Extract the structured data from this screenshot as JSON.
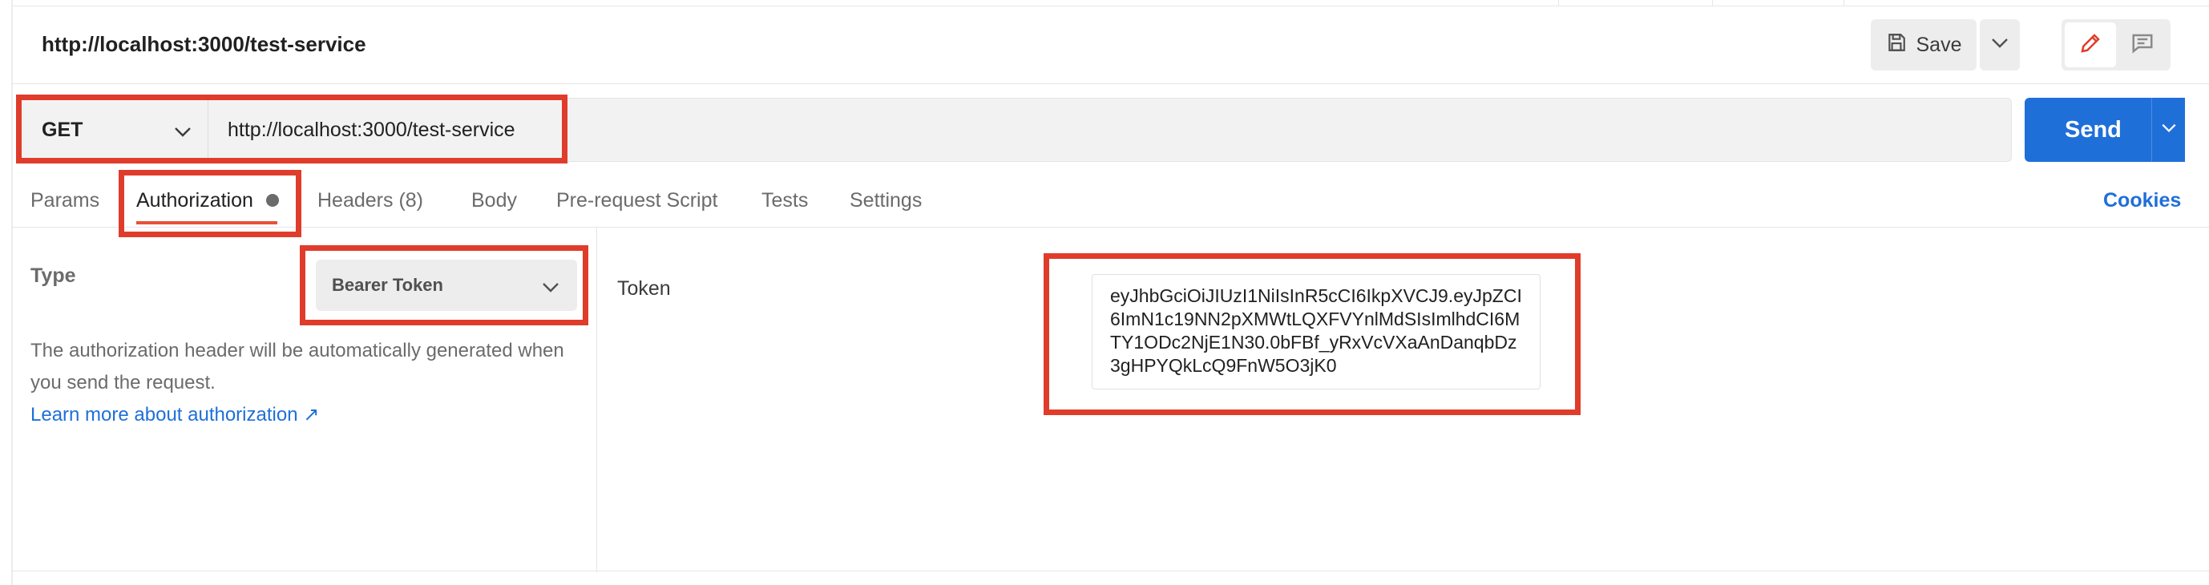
{
  "request": {
    "title": "http://localhost:3000/test-service",
    "method": "GET",
    "url": "http://localhost:3000/test-service"
  },
  "header": {
    "save_label": "Save"
  },
  "send": {
    "label": "Send"
  },
  "tabs": [
    {
      "label": "Params"
    },
    {
      "label": "Authorization"
    },
    {
      "label": "Headers (8)"
    },
    {
      "label": "Body"
    },
    {
      "label": "Pre-request Script"
    },
    {
      "label": "Tests"
    },
    {
      "label": "Settings"
    }
  ],
  "cookies_label": "Cookies",
  "auth": {
    "type_label": "Type",
    "type_value": "Bearer Token",
    "description": "The authorization header will be automatically generated when you send the request.",
    "learn_more": "Learn more about authorization ↗",
    "token_label": "Token",
    "token_value": "eyJhbGciOiJIUzI1NiIsInR5cCI6IkpXVCJ9.eyJpZCI6ImN1c19NN2pXMWtLQXFVYnlMdSIsImlhdCI6MTY1ODc2NjE1N30.0bFBf_yRxVcVXaAnDanqbDz3gHPYQkLcQ9FnW5O3jK0"
  },
  "colors": {
    "accent": "#1f6fd9",
    "highlight": "#e03c2b",
    "active_tab_underline": "#e8503a"
  },
  "icons": [
    "save-icon",
    "chevron-down-icon",
    "pencil-icon",
    "comment-icon"
  ]
}
